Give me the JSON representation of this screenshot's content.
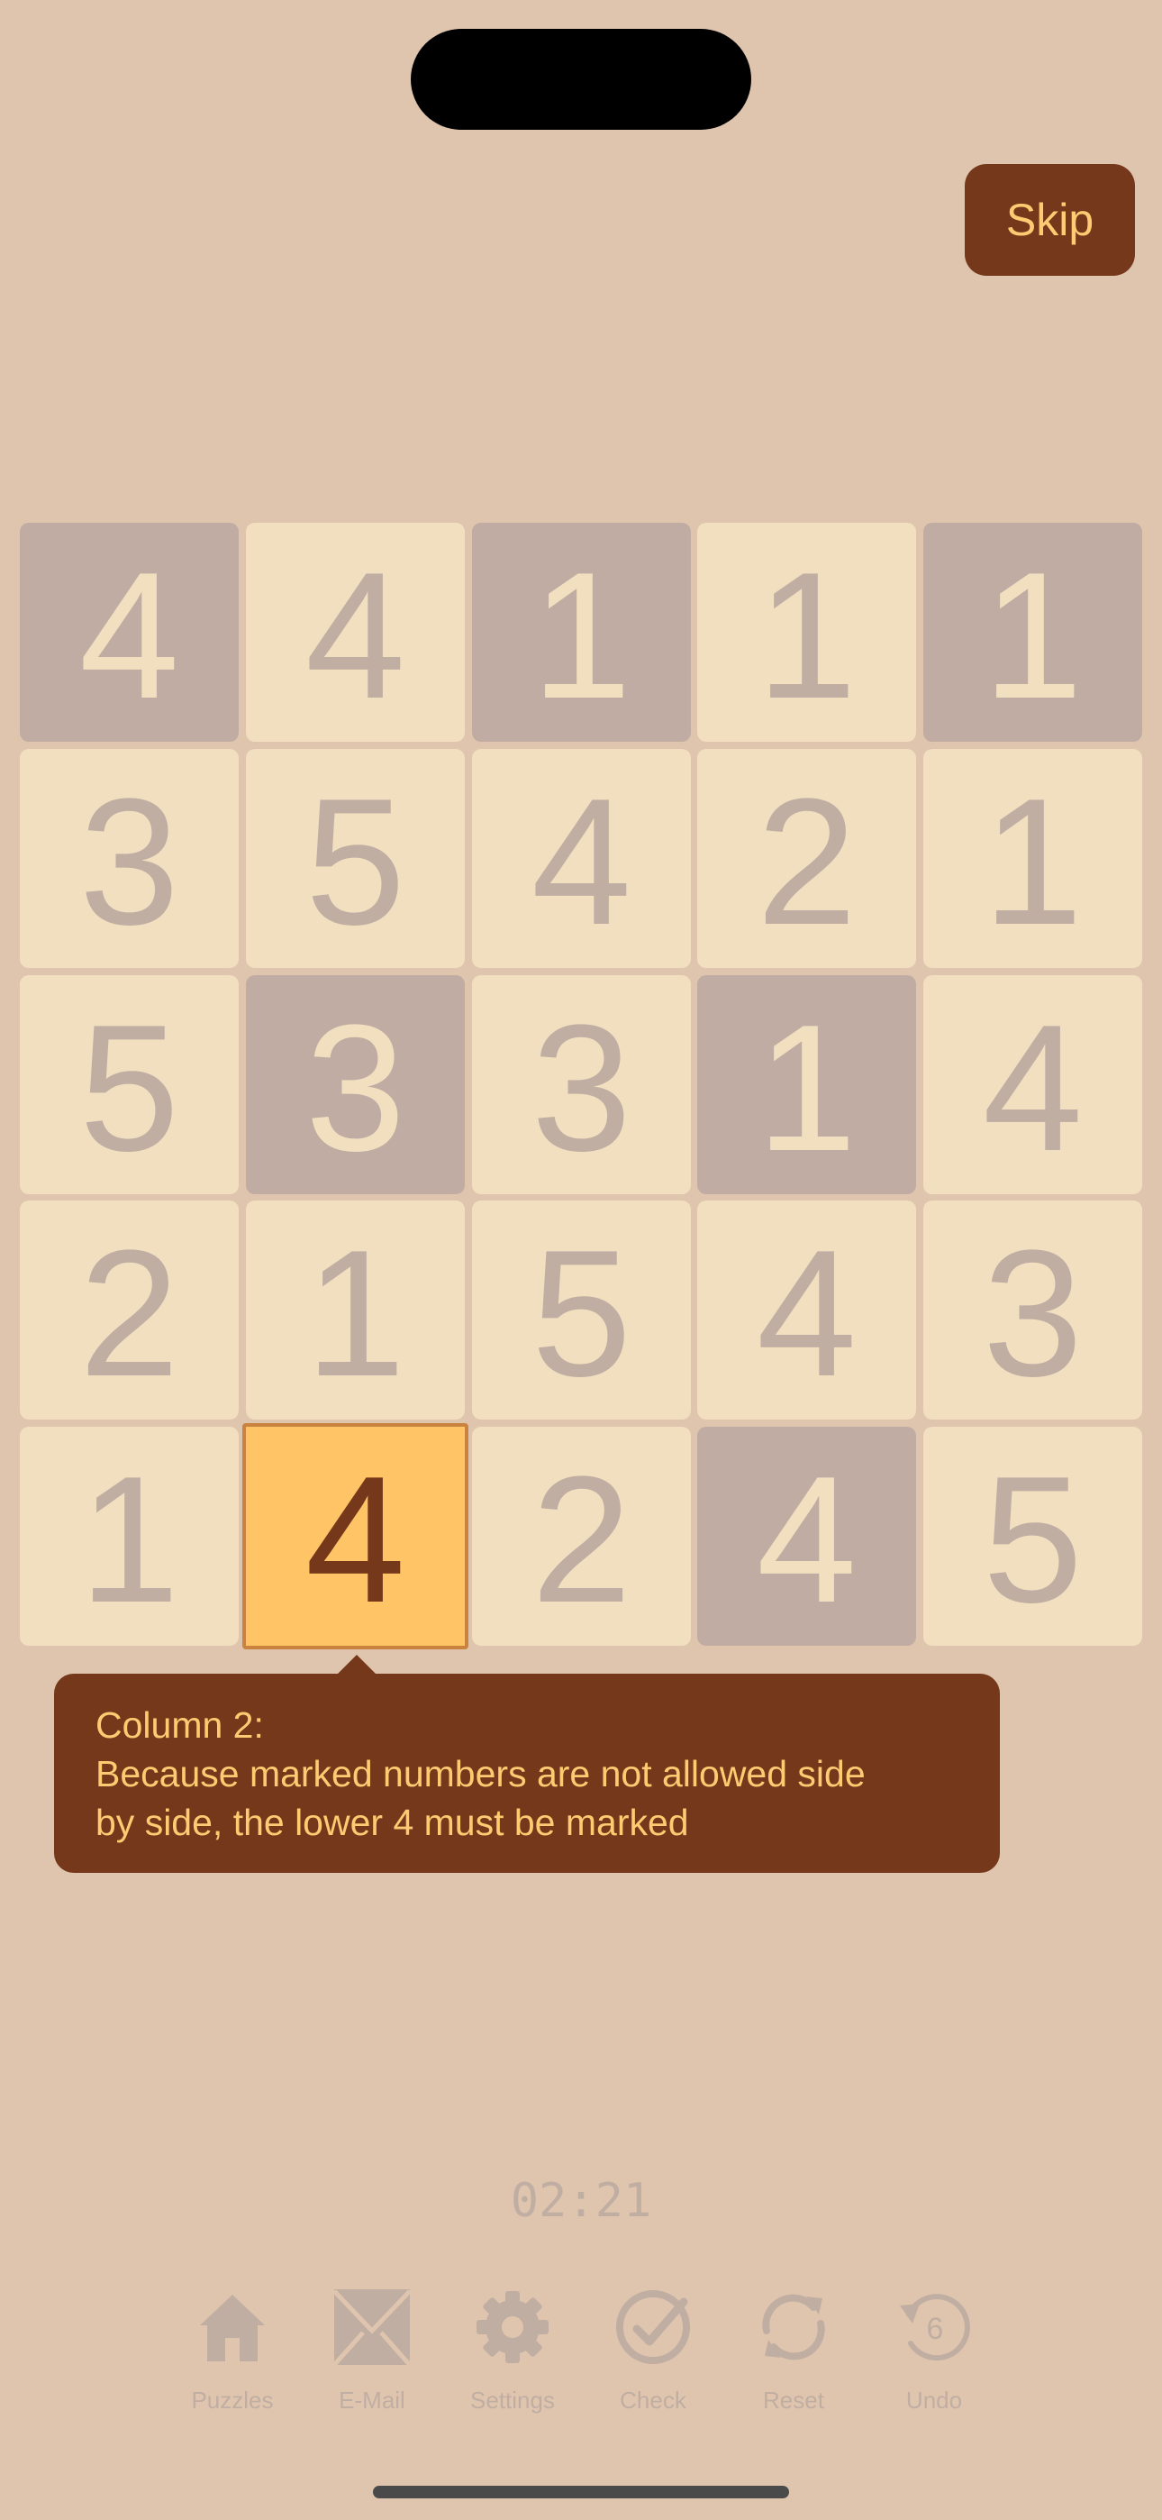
{
  "header": {
    "skip_label": "Skip"
  },
  "grid": {
    "rows": [
      [
        {
          "value": "4",
          "state": "marked"
        },
        {
          "value": "4",
          "state": "plain"
        },
        {
          "value": "1",
          "state": "marked"
        },
        {
          "value": "1",
          "state": "plain"
        },
        {
          "value": "1",
          "state": "marked"
        }
      ],
      [
        {
          "value": "3",
          "state": "plain"
        },
        {
          "value": "5",
          "state": "plain"
        },
        {
          "value": "4",
          "state": "plain"
        },
        {
          "value": "2",
          "state": "plain"
        },
        {
          "value": "1",
          "state": "plain"
        }
      ],
      [
        {
          "value": "5",
          "state": "plain"
        },
        {
          "value": "3",
          "state": "marked"
        },
        {
          "value": "3",
          "state": "plain"
        },
        {
          "value": "1",
          "state": "marked"
        },
        {
          "value": "4",
          "state": "plain"
        }
      ],
      [
        {
          "value": "2",
          "state": "plain"
        },
        {
          "value": "1",
          "state": "plain"
        },
        {
          "value": "5",
          "state": "plain"
        },
        {
          "value": "4",
          "state": "plain"
        },
        {
          "value": "3",
          "state": "plain"
        }
      ],
      [
        {
          "value": "1",
          "state": "plain"
        },
        {
          "value": "4",
          "state": "selected"
        },
        {
          "value": "2",
          "state": "plain"
        },
        {
          "value": "4",
          "state": "marked"
        },
        {
          "value": "5",
          "state": "plain"
        }
      ]
    ]
  },
  "hint": {
    "text": "Column 2:\nBecause marked numbers are not allowed side\nby side, the lower 4 must be marked"
  },
  "timer": {
    "value": "02:21"
  },
  "toolbar": {
    "puzzles_label": "Puzzles",
    "email_label": "E-Mail",
    "settings_label": "Settings",
    "check_label": "Check",
    "reset_label": "Reset",
    "undo_label": "Undo",
    "undo_count": "6"
  },
  "colors": {
    "background": "#dfc5ae",
    "cell_plain": "#f1dfc0",
    "cell_marked": "#c0aca2",
    "cell_selected": "#ffc466",
    "accent_dark": "#75381b",
    "accent_text": "#ffcb72",
    "muted": "#c1aea3"
  }
}
